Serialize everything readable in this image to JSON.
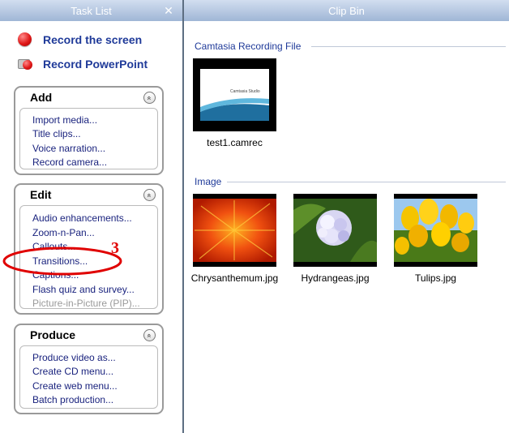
{
  "task_list": {
    "title": "Task List",
    "close_glyph": "✕",
    "record_screen": "Record the screen",
    "record_powerpoint": "Record PowerPoint",
    "add": {
      "title": "Add",
      "items": [
        "Import media...",
        "Title clips...",
        "Voice narration...",
        "Record camera..."
      ]
    },
    "edit": {
      "title": "Edit",
      "items": [
        "Audio enhancements...",
        "Zoom-n-Pan...",
        "Callouts...",
        "Transitions...",
        "Captions...",
        "Flash quiz and survey...",
        "Picture-in-Picture (PIP)..."
      ]
    },
    "produce": {
      "title": "Produce",
      "items": [
        "Produce video as...",
        "Create CD menu...",
        "Create web menu...",
        "Batch production..."
      ]
    },
    "collapse_glyph": "«"
  },
  "clip_bin": {
    "title": "Clip Bin",
    "groups": [
      {
        "label": "Camtasia Recording File",
        "clips": [
          {
            "name": "test1.camrec",
            "thumb_text": "Camtasia Studio"
          }
        ]
      },
      {
        "label": "Image",
        "clips": [
          {
            "name": "Chrysanthemum.jpg"
          },
          {
            "name": "Hydrangeas.jpg"
          },
          {
            "name": "Tulips.jpg"
          }
        ]
      }
    ]
  },
  "annotation": {
    "step_number": "3",
    "color": "#e00000"
  },
  "colors": {
    "accent": "#1f3a99",
    "link": "#1a237e",
    "header_top": "#d2def0",
    "header_bottom": "#9fb6d6"
  }
}
